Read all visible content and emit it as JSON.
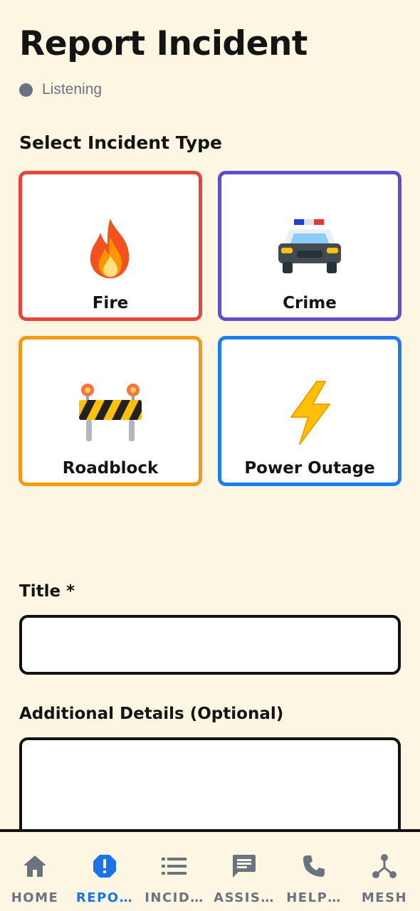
{
  "header": {
    "title": "Report Incident",
    "status": "Listening"
  },
  "incident_section": {
    "heading": "Select Incident Type",
    "types": [
      {
        "label": "Fire",
        "icon": "fire-icon",
        "border": "#e8443a"
      },
      {
        "label": "Crime",
        "icon": "police-car-icon",
        "border": "#5b4fcf"
      },
      {
        "label": "Roadblock",
        "icon": "roadblock-icon",
        "border": "#f39a13"
      },
      {
        "label": "Power Outage",
        "icon": "lightning-icon",
        "border": "#1a7ef2"
      }
    ]
  },
  "form": {
    "title_label": "Title *",
    "title_value": "",
    "details_label": "Additional Details (Optional)",
    "details_value": ""
  },
  "tabbar": {
    "items": [
      {
        "label": "HOME",
        "icon": "home-icon"
      },
      {
        "label": "REPO…",
        "icon": "alert-icon",
        "active": true
      },
      {
        "label": "INCID…",
        "icon": "list-icon"
      },
      {
        "label": "ASSIS…",
        "icon": "chat-icon"
      },
      {
        "label": "HELP…",
        "icon": "phone-icon"
      },
      {
        "label": "MESH",
        "icon": "mesh-icon"
      }
    ],
    "active_color": "#1a73e8",
    "inactive_color": "#6b7380"
  }
}
